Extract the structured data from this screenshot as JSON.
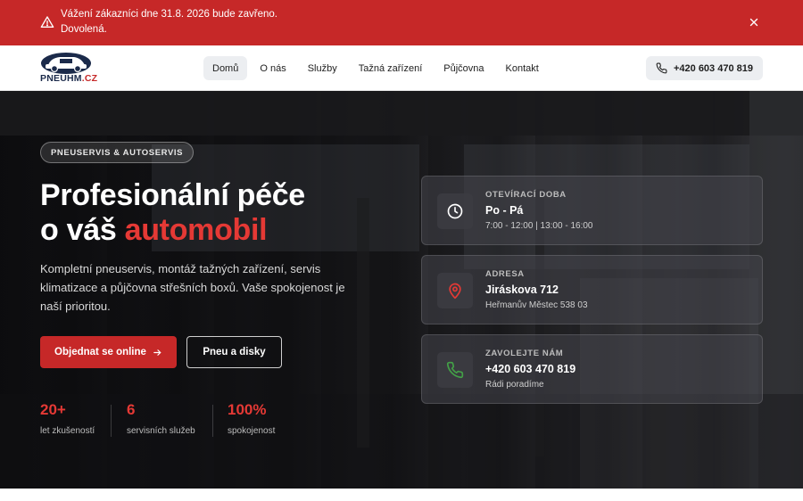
{
  "alert": {
    "line1": "Vážení zákazníci dne 31.8. 2026 bude zavřeno.",
    "line2": "Dovolená."
  },
  "logo": {
    "text_main": "PNEUHM",
    "text_tld": ".CZ"
  },
  "nav": {
    "items": [
      {
        "label": "Domů",
        "active": true
      },
      {
        "label": "O nás",
        "active": false
      },
      {
        "label": "Služby",
        "active": false
      },
      {
        "label": "Tažná zařízení",
        "active": false
      },
      {
        "label": "Půjčovna",
        "active": false
      },
      {
        "label": "Kontakt",
        "active": false
      }
    ],
    "phone": "+420 603 470 819"
  },
  "hero": {
    "badge": "PNEUSERVIS & AUTOSERVIS",
    "headline_line1": "Profesionální péče",
    "headline_line2_prefix": "o váš ",
    "headline_accent": "automobil",
    "lead": "Kompletní pneuservis, montáž tažných zařízení, servis klimatizace a půjčovna střešních boxů. Vaše spokojenost je naší prioritou.",
    "primary_button": "Objednat se online",
    "secondary_button": "Pneu a disky",
    "stats": [
      {
        "value": "20+",
        "label": "let zkušeností"
      },
      {
        "value": "6",
        "label": "servisních služeb"
      },
      {
        "value": "100%",
        "label": "spokojenost"
      }
    ]
  },
  "cards": [
    {
      "icon": "clock-icon",
      "label": "OTEVÍRACÍ DOBA",
      "title": "Po - Pá",
      "sub": "7:00 - 12:00 | 13:00 - 16:00"
    },
    {
      "icon": "map-pin-icon",
      "label": "ADRESA",
      "title": "Jiráskova 712",
      "sub": "Heřmanův Městec 538 03"
    },
    {
      "icon": "phone-icon",
      "label": "ZAVOLEJTE NÁM",
      "title": "+420 603 470 819",
      "sub": "Rádi poradíme"
    }
  ],
  "colors": {
    "brand_red": "#c62828",
    "accent_red": "#e53935",
    "navy": "#1b2a4a",
    "clock_icon": "#ffffff",
    "pin_icon": "#e53935",
    "phone_icon": "#43a047"
  }
}
